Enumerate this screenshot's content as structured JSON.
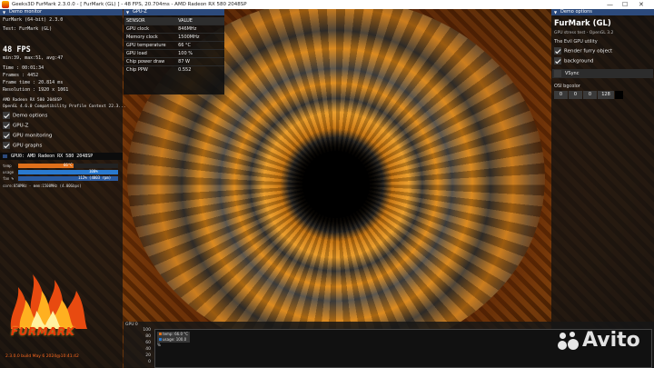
{
  "window": {
    "title": "Geeks3D FurMark 2.3.0.0 - [ FurMark (GL) ] - 48 FPS, 20.704ms - AMD Radeon RX 580 2048SP",
    "controls": [
      "—",
      "☐",
      "✕"
    ]
  },
  "left": {
    "header": "Demo monitor",
    "app_line": "FurMark (64-bit) 2.3.0",
    "test_line": "Test: FurMark (GL)",
    "fps": "48 FPS",
    "fps_stats": "min:39, max:51, avg:47",
    "time": "Time        : 00:01:34",
    "frames": "Frames      : 4452",
    "frame_time": "Frame time  : 20.814 ms",
    "resolution": "Resolution  : 1920 x 1061",
    "gpu_name": "AMD Radeon RX 580 2048SP",
    "gl_info": "OpenGL 4.6.0 Compatibility Profile Context 22.3...",
    "options": [
      {
        "label": "Demo options",
        "checked": true
      },
      {
        "label": "GPU-Z",
        "checked": true
      },
      {
        "label": "GPU monitoring",
        "checked": true
      },
      {
        "label": "GPU graphs",
        "checked": true
      }
    ],
    "gpu_header": "GPU0: AMD Radeon RX 580 2048SP",
    "bars": [
      {
        "label": "temp",
        "text": "66°C",
        "fraction": 0.55,
        "color": "#e0701a"
      },
      {
        "label": "usage",
        "text": "100%",
        "fraction": 1.0,
        "color": "#2a7ad0"
      },
      {
        "label": "fan %",
        "text": "112% (4003 rpm)",
        "fraction": 1.0,
        "color": "#2a5aa0"
      }
    ],
    "clock_line": "core:850MHz - mem:1500MHz (4.00Gbps)"
  },
  "gpuz": {
    "header": "GPU-Z",
    "col_sensor": "SENSOR",
    "col_value": "VALUE",
    "rows": [
      {
        "sensor": "GPU clock",
        "value": "846MHz"
      },
      {
        "sensor": "Memory clock",
        "value": "1500MHz"
      },
      {
        "sensor": "GPU temperature",
        "value": "66 °C"
      },
      {
        "sensor": "GPU load",
        "value": "100 %"
      },
      {
        "sensor": "Chip power draw",
        "value": "87 W"
      },
      {
        "sensor": "Chip PPW",
        "value": "0.552"
      }
    ]
  },
  "right": {
    "header": "Demo options",
    "title": "FurMark (GL)",
    "subtitle": "GPU stress test - OpenGL 3.2",
    "evil_utility": "The Evil GPU utility",
    "options": [
      {
        "label": "Render furry object",
        "checked": true
      },
      {
        "label": "background",
        "checked": true
      }
    ],
    "vsync": "VSync",
    "bg_label": "OSI bgcolor",
    "bg_values": [
      "0",
      "0",
      "0",
      "128"
    ]
  },
  "graph": {
    "label": "GPU 0",
    "y_ticks": [
      "100",
      "80",
      "60",
      "40",
      "20",
      "0"
    ],
    "legend_temp": "temp: 66.0 °C",
    "legend_usage": "usage: 100.0 %"
  },
  "logo": {
    "wordmark": "FURMARK",
    "build": "2.3.0.0 build May 6 2024@10:41:42"
  },
  "watermark": {
    "text": "Avito"
  }
}
